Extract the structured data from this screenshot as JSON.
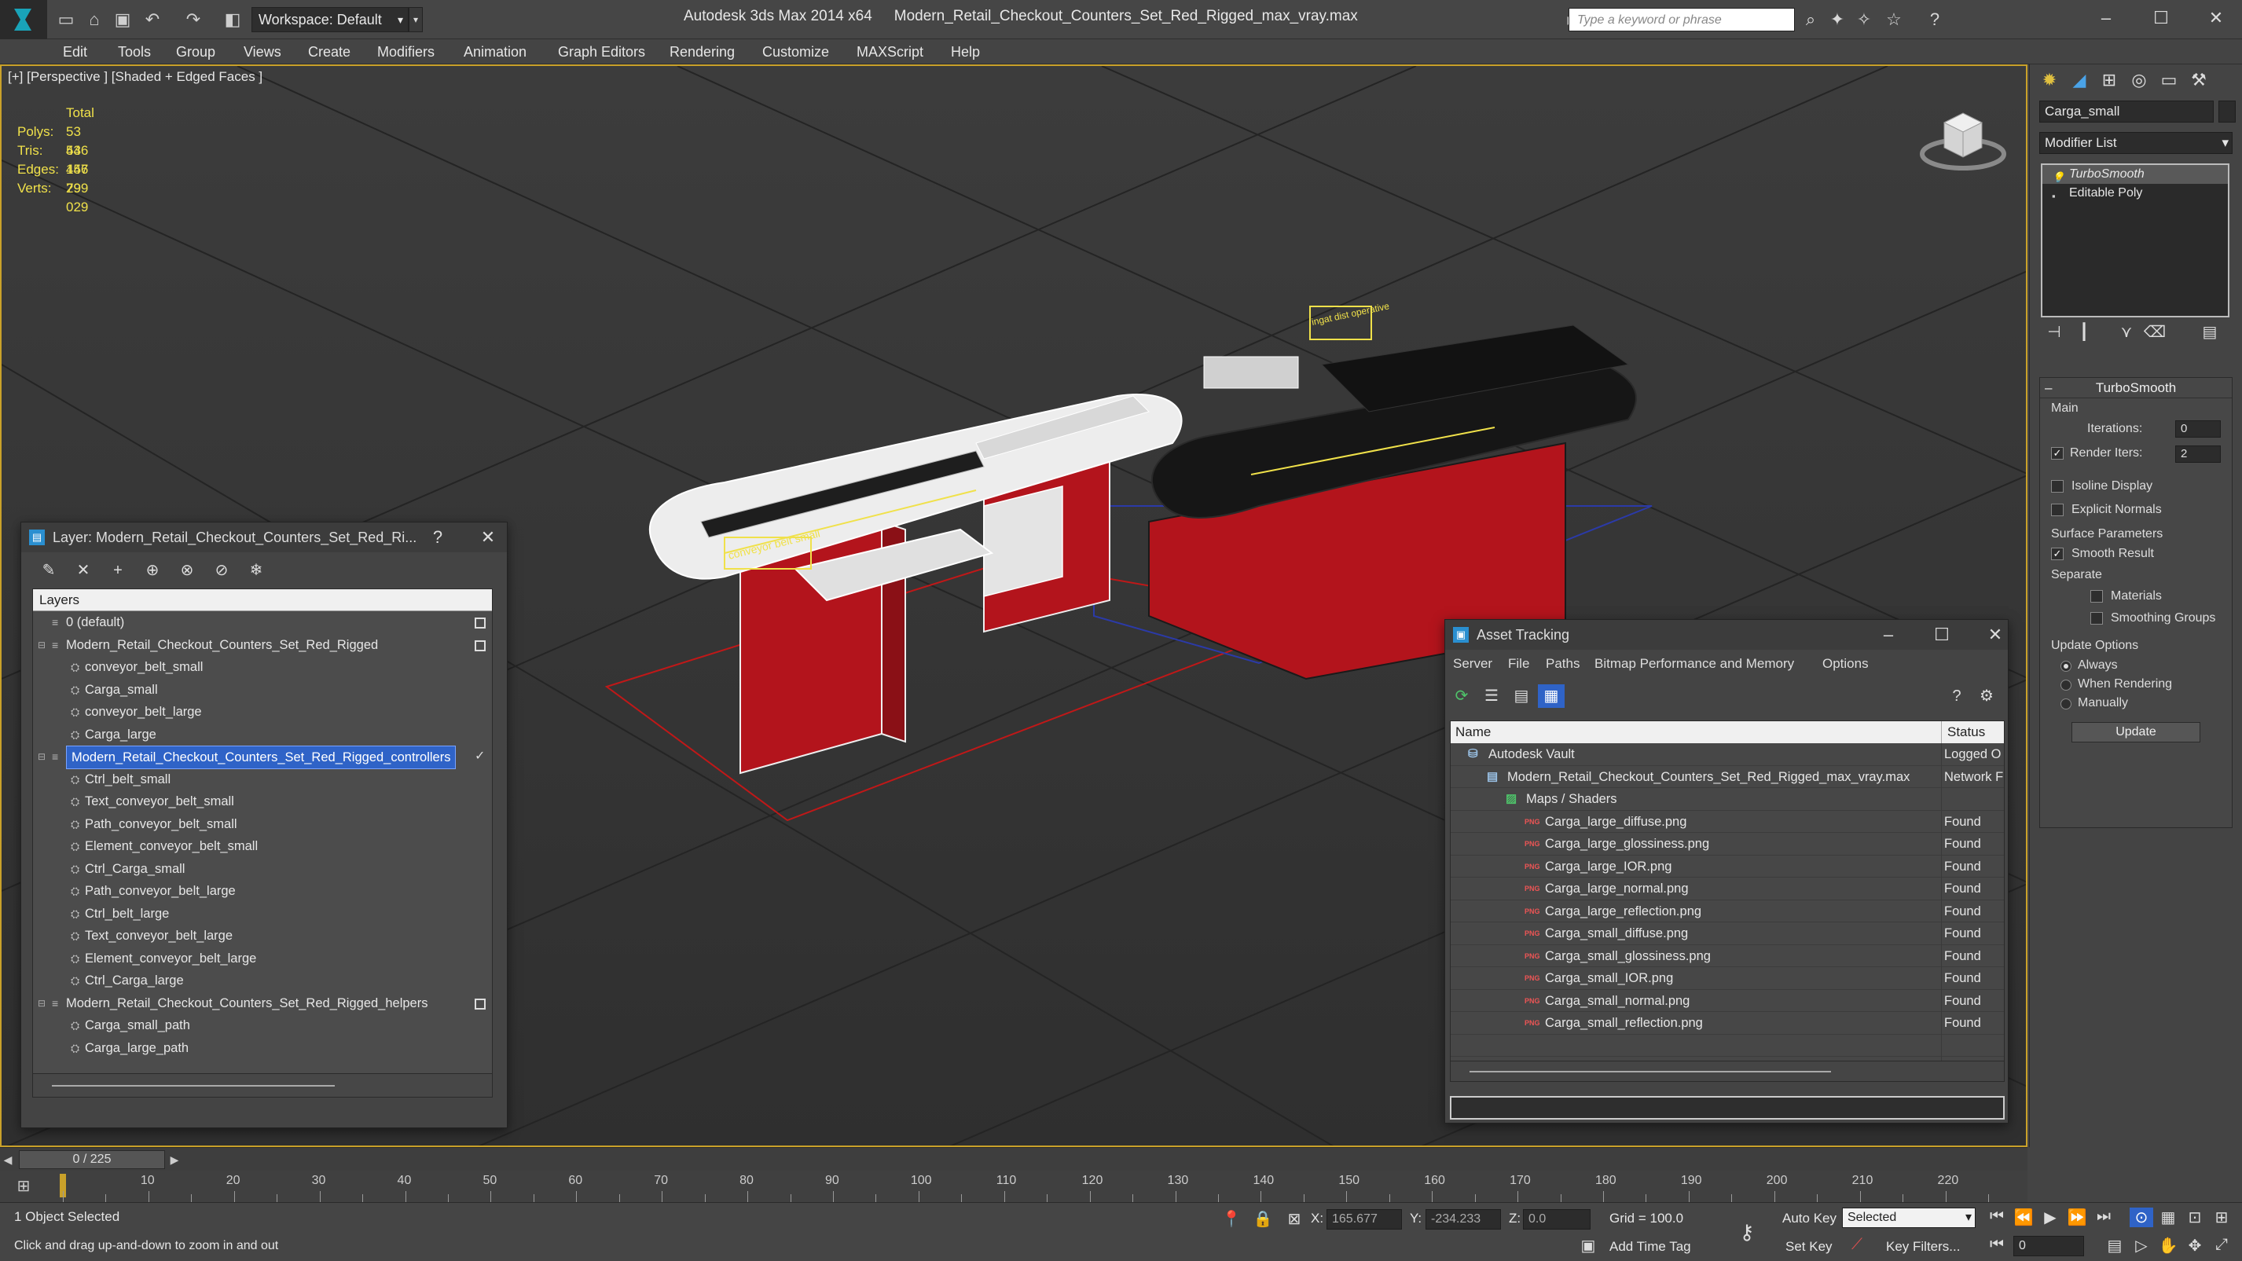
{
  "window": {
    "app": "Autodesk 3ds Max  2014 x64",
    "file": "Modern_Retail_Checkout_Counters_Set_Red_Rigged_max_vray.max",
    "workspace": "Workspace: Default",
    "search_placeholder": "Type a keyword or phrase"
  },
  "menu": [
    "Edit",
    "Tools",
    "Group",
    "Views",
    "Create",
    "Modifiers",
    "Animation",
    "Graph Editors",
    "Rendering",
    "Customize",
    "MAXScript",
    "Help"
  ],
  "viewport": {
    "label": "[+] [Perspective ] [Shaded + Edged Faces ]",
    "stats": {
      "total_label": "Total",
      "rows": [
        {
          "k": "Polys:",
          "v": "53 446"
        },
        {
          "k": "Tris:",
          "v": "53 446"
        },
        {
          "k": "Edges:",
          "v": "157 799"
        },
        {
          "k": "Verts:",
          "v": "29 029"
        }
      ]
    },
    "scene_labels": [
      "conveyor belt small",
      "ingat dist operative"
    ]
  },
  "command_panel": {
    "object_name": "Carga_small",
    "modifier_list": "Modifier List",
    "stack": [
      "TurboSmooth",
      "Editable Poly"
    ],
    "turbosmooth": {
      "title": "TurboSmooth",
      "main": "Main",
      "iterations_label": "Iterations:",
      "iterations": "0",
      "render_iters_label": "Render Iters:",
      "render_iters": "2",
      "isoline": "Isoline Display",
      "explicit_normals": "Explicit Normals",
      "surface_params": "Surface Parameters",
      "smooth_result": "Smooth Result",
      "separate": "Separate",
      "materials": "Materials",
      "smoothing_groups": "Smoothing Groups",
      "update_options": "Update Options",
      "always": "Always",
      "when_rendering": "When Rendering",
      "manually": "Manually",
      "update_btn": "Update"
    }
  },
  "layer_window": {
    "title": "Layer: Modern_Retail_Checkout_Counters_Set_Red_Ri...",
    "help": "?",
    "header": "Layers",
    "rows": [
      {
        "text": "0 (default)",
        "level": 0,
        "kind": "layer",
        "box": true
      },
      {
        "text": "Modern_Retail_Checkout_Counters_Set_Red_Rigged",
        "level": 0,
        "kind": "layer",
        "box": true,
        "expand": true
      },
      {
        "text": "conveyor_belt_small",
        "level": 1,
        "kind": "obj"
      },
      {
        "text": "Carga_small",
        "level": 1,
        "kind": "obj"
      },
      {
        "text": "conveyor_belt_large",
        "level": 1,
        "kind": "obj"
      },
      {
        "text": "Carga_large",
        "level": 1,
        "kind": "obj"
      },
      {
        "text": "Modern_Retail_Checkout_Counters_Set_Red_Rigged_controllers",
        "level": 0,
        "kind": "layer",
        "selected": true,
        "expand": true,
        "check": true
      },
      {
        "text": "Ctrl_belt_small",
        "level": 1,
        "kind": "obj"
      },
      {
        "text": "Text_conveyor_belt_small",
        "level": 1,
        "kind": "obj"
      },
      {
        "text": "Path_conveyor_belt_small",
        "level": 1,
        "kind": "obj"
      },
      {
        "text": "Element_conveyor_belt_small",
        "level": 1,
        "kind": "obj"
      },
      {
        "text": "Ctrl_Carga_small",
        "level": 1,
        "kind": "obj"
      },
      {
        "text": "Path_conveyor_belt_large",
        "level": 1,
        "kind": "obj"
      },
      {
        "text": "Ctrl_belt_large",
        "level": 1,
        "kind": "obj"
      },
      {
        "text": "Text_conveyor_belt_large",
        "level": 1,
        "kind": "obj"
      },
      {
        "text": "Element_conveyor_belt_large",
        "level": 1,
        "kind": "obj"
      },
      {
        "text": "Ctrl_Carga_large",
        "level": 1,
        "kind": "obj"
      },
      {
        "text": "Modern_Retail_Checkout_Counters_Set_Red_Rigged_helpers",
        "level": 0,
        "kind": "layer",
        "box": true,
        "expand": true
      },
      {
        "text": "Carga_small_path",
        "level": 1,
        "kind": "obj"
      },
      {
        "text": "Carga_large_path",
        "level": 1,
        "kind": "obj"
      }
    ]
  },
  "asset_window": {
    "title": "Asset Tracking",
    "menu": [
      "Server",
      "File",
      "Paths",
      "Bitmap Performance and Memory",
      "Options"
    ],
    "col_name": "Name",
    "col_status": "Status",
    "rows": [
      {
        "name": "Autodesk Vault",
        "status": "Logged O",
        "level": 0,
        "icon": "vault"
      },
      {
        "name": "Modern_Retail_Checkout_Counters_Set_Red_Rigged_max_vray.max",
        "status": "Network F",
        "level": 1,
        "icon": "file"
      },
      {
        "name": "Maps / Shaders",
        "status": "",
        "level": 2,
        "icon": "maps"
      },
      {
        "name": "Carga_large_diffuse.png",
        "status": "Found",
        "level": 3,
        "icon": "png"
      },
      {
        "name": "Carga_large_glossiness.png",
        "status": "Found",
        "level": 3,
        "icon": "png"
      },
      {
        "name": "Carga_large_IOR.png",
        "status": "Found",
        "level": 3,
        "icon": "png"
      },
      {
        "name": "Carga_large_normal.png",
        "status": "Found",
        "level": 3,
        "icon": "png"
      },
      {
        "name": "Carga_large_reflection.png",
        "status": "Found",
        "level": 3,
        "icon": "png"
      },
      {
        "name": "Carga_small_diffuse.png",
        "status": "Found",
        "level": 3,
        "icon": "png"
      },
      {
        "name": "Carga_small_glossiness.png",
        "status": "Found",
        "level": 3,
        "icon": "png"
      },
      {
        "name": "Carga_small_IOR.png",
        "status": "Found",
        "level": 3,
        "icon": "png"
      },
      {
        "name": "Carga_small_normal.png",
        "status": "Found",
        "level": 3,
        "icon": "png"
      },
      {
        "name": "Carga_small_reflection.png",
        "status": "Found",
        "level": 3,
        "icon": "png"
      }
    ]
  },
  "timeline": {
    "frame": "0 / 225",
    "ticks": [
      "10",
      "20",
      "30",
      "40",
      "50",
      "60",
      "70",
      "80",
      "90",
      "100",
      "110",
      "120",
      "130",
      "140",
      "150",
      "160",
      "170",
      "180",
      "190",
      "200",
      "210",
      "220"
    ]
  },
  "status": {
    "selected": "1 Object Selected",
    "hint": "Click and drag up-and-down to zoom in and out",
    "x_label": "X:",
    "x": "165.677",
    "y_label": "Y:",
    "y": "-234.233",
    "z_label": "Z:",
    "z": "0.0",
    "grid": "Grid = 100.0",
    "auto_key": "Auto Key",
    "set_key": "Set Key",
    "key_mode": "Selected",
    "key_filters": "Key Filters...",
    "add_time_tag": "Add Time Tag",
    "frame_field": "0"
  },
  "colors": {
    "accent": "#2f63c7",
    "counter_red": "#b3141c",
    "viewport_border": "#c9a12a",
    "stat_yellow": "#f0e14a"
  }
}
